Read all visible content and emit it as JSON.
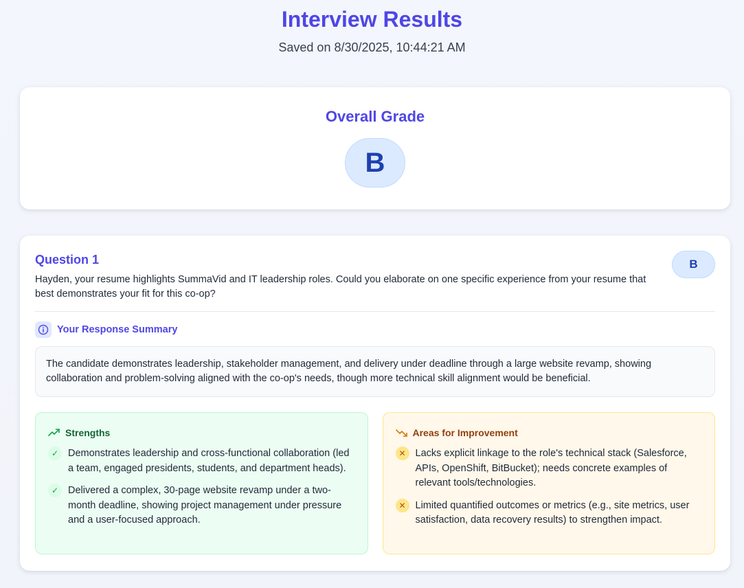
{
  "header": {
    "title": "Interview Results",
    "saved": "Saved on 8/30/2025, 10:44:21 AM"
  },
  "overall": {
    "label": "Overall Grade",
    "grade": "B"
  },
  "question": {
    "title": "Question 1",
    "text": "Hayden, your resume highlights SummaVid and IT leadership roles. Could you elaborate on one specific experience from your resume that best demonstrates your fit for this co-op?",
    "grade": "B",
    "summary_title": "Your Response Summary",
    "summary": "The candidate demonstrates leadership, stakeholder management, and delivery under deadline through a large website revamp, showing collaboration and problem-solving aligned with the co-op's needs, though more technical skill alignment would be beneficial.",
    "strengths_title": "Strengths",
    "strengths": [
      "Demonstrates leadership and cross-functional collaboration (led a team, engaged presidents, students, and department heads).",
      "Delivered a complex, 30-page website revamp under a two-month deadline, showing project management under pressure and a user-focused approach."
    ],
    "improvements_title": "Areas for Improvement",
    "improvements": [
      "Lacks explicit linkage to the role's technical stack (Salesforce, APIs, OpenShift, BitBucket); needs concrete examples of relevant tools/technologies.",
      "Limited quantified outcomes or metrics (e.g., site metrics, user satisfaction, data recovery results) to strengthen impact."
    ]
  },
  "icons": {
    "summary": "info-icon",
    "strengths": "trending-up-icon",
    "improvements": "trending-down-icon",
    "strength_bullet": "check-icon",
    "improvement_bullet": "x-icon"
  },
  "colors": {
    "accent": "#4f46e5",
    "grade_bg": "#dbeafe",
    "grade_text": "#1e40af",
    "strengths_bg": "#ecfdf3",
    "improvements_bg": "#fff8eb"
  }
}
